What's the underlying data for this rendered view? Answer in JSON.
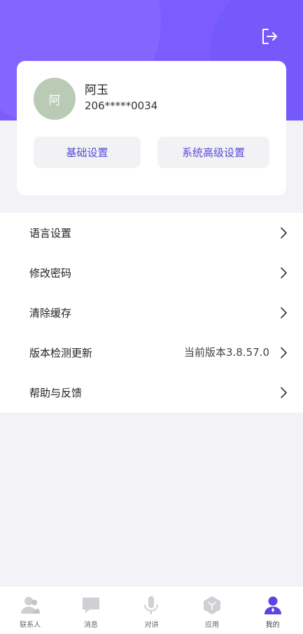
{
  "header": {
    "logout_icon": "logout-icon",
    "accent_color": "#7c5cff"
  },
  "profile": {
    "avatar_text": "阿",
    "name": "阿玉",
    "phone": "206*****0034",
    "basic_settings_label": "基础设置",
    "advanced_settings_label": "系统高级设置"
  },
  "menu": {
    "items": [
      {
        "label": "语言设置",
        "value": ""
      },
      {
        "label": "修改密码",
        "value": ""
      },
      {
        "label": "清除缓存",
        "value": ""
      },
      {
        "label": "版本检测更新",
        "value": "当前版本3.8.57.0"
      },
      {
        "label": "帮助与反馈",
        "value": ""
      }
    ]
  },
  "tabbar": {
    "tabs": [
      {
        "label": "联系人",
        "icon": "contacts-icon",
        "active": false
      },
      {
        "label": "消息",
        "icon": "message-icon",
        "active": false
      },
      {
        "label": "对讲",
        "icon": "microphone-icon",
        "active": false
      },
      {
        "label": "应用",
        "icon": "apps-cube-icon",
        "active": false
      },
      {
        "label": "我的",
        "icon": "profile-icon",
        "active": true
      }
    ],
    "inactive_color": "#cfcfd4",
    "active_color": "#5b45e0"
  }
}
